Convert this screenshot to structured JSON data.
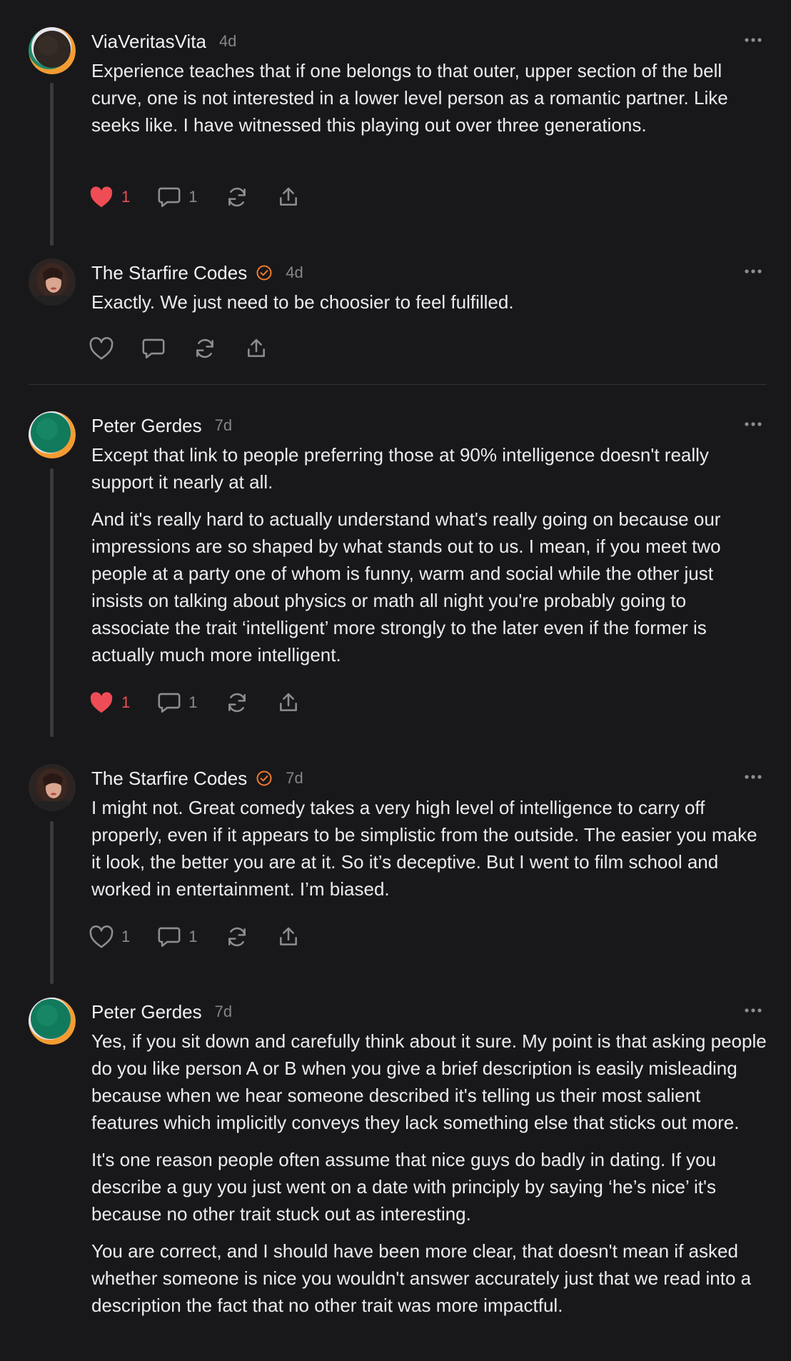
{
  "comments": [
    {
      "author": "ViaVeritasVita",
      "age": "4d",
      "paragraphs": [
        "Experience teaches that if one belongs to that outer, upper section of the bell curve, one is not interested in a lower level person as a romantic partner. Like seeks like. I have witnessed this playing out over three generations."
      ],
      "likes": "1",
      "replies": "1",
      "liked": true
    },
    {
      "author": "The Starfire Codes",
      "age": "4d",
      "paragraphs": [
        "Exactly. We just need to be choosier to feel fulfilled."
      ],
      "likes": "",
      "replies": "",
      "liked": false
    },
    {
      "author": "Peter Gerdes",
      "age": "7d",
      "paragraphs": [
        "Except that link to people preferring those at 90% intelligence doesn't really support it nearly at all.",
        "And it's really hard to actually understand what's really going on because our impressions are so shaped by what stands out to us. I mean, if you meet two people at a party one of whom is funny, warm and social while the other just insists on talking about physics or math all night you're probably going to associate the trait ‘intelligent’ more strongly to the later even if the former is actually much more intelligent."
      ],
      "likes": "1",
      "replies": "1",
      "liked": true
    },
    {
      "author": "The Starfire Codes",
      "age": "7d",
      "paragraphs": [
        "I might not. Great comedy takes a very high level of intelligence to carry off properly, even if it appears to be simplistic from the outside. The easier you make it look, the better you are at it. So it’s deceptive. But I went to film school and worked in entertainment. I’m biased."
      ],
      "likes": "1",
      "replies": "1",
      "liked": false
    },
    {
      "author": "Peter Gerdes",
      "age": "7d",
      "paragraphs": [
        "Yes, if you sit down and carefully think about it sure. My point is that asking people do you like person A or B when you give a brief description is easily misleading because when we hear someone described it's telling us their most salient features which implicitly conveys they lack something else that sticks out more.",
        "It's one reason people often assume that nice guys do badly in dating. If you describe a guy you just went on a date with principly by saying ‘he’s nice’ it's because no other trait stuck out as interesting.",
        "You are correct, and I should have been more clear, that doesn't mean if asked whether someone is nice you wouldn't answer accurately just that we read into a description the fact that no other trait was more impactful."
      ],
      "likes": "",
      "replies": "",
      "liked": false
    }
  ],
  "colors": {
    "background": "#18181a",
    "text": "#ececee",
    "muted": "#85858b",
    "like_active": "#ef4d55",
    "verified_badge": "#f07b2d",
    "thread_line": "#3a3a3d"
  },
  "icons": {
    "like": "heart-icon",
    "reply": "comment-bubble-icon",
    "restack": "restack-icon",
    "share": "share-icon",
    "more": "more-dots-icon",
    "verified": "verified-check-icon"
  }
}
